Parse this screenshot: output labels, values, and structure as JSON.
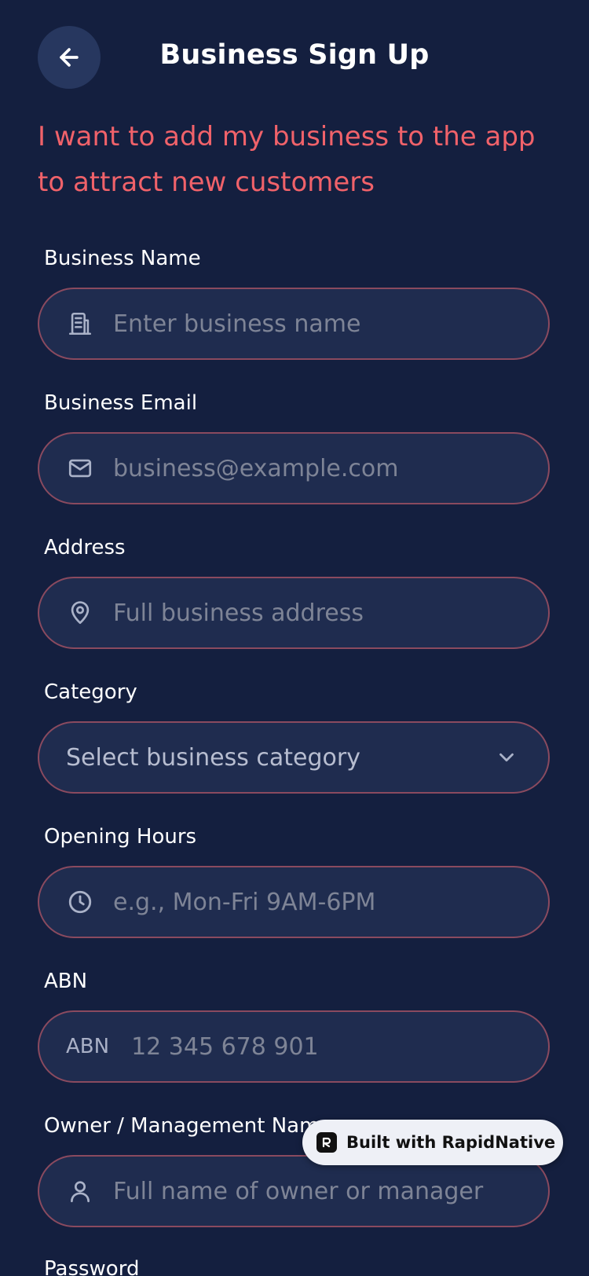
{
  "header": {
    "title": "Business Sign Up",
    "back_icon": "arrow-left-icon"
  },
  "tagline": "I want to add my business to the app to attract new customers",
  "form": {
    "business_name": {
      "label": "Business Name",
      "placeholder": "Enter business name",
      "icon": "building-icon"
    },
    "business_email": {
      "label": "Business Email",
      "placeholder": "business@example.com",
      "icon": "mail-icon"
    },
    "address": {
      "label": "Address",
      "placeholder": "Full business address",
      "icon": "map-pin-icon"
    },
    "category": {
      "label": "Category",
      "selected": "Select business category",
      "icon": "chevron-down-icon"
    },
    "opening_hours": {
      "label": "Opening Hours",
      "placeholder": "e.g., Mon-Fri 9AM-6PM",
      "icon": "clock-icon"
    },
    "abn": {
      "label": "ABN",
      "prefix": "ABN",
      "placeholder": "12 345 678 901"
    },
    "owner_name": {
      "label": "Owner / Management Name",
      "placeholder": "Full name of owner or manager",
      "icon": "user-icon"
    },
    "password": {
      "label": "Password"
    }
  },
  "badge": {
    "text": "Built with RapidNative"
  },
  "colors": {
    "background": "#141f3f",
    "input_background": "#1f2c4f",
    "input_border": "#8a4a5f",
    "accent": "#f0626a"
  }
}
